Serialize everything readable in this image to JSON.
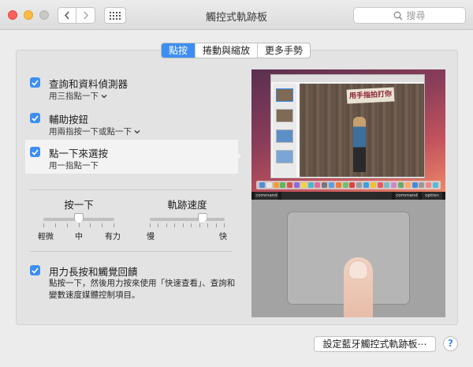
{
  "window": {
    "title": "觸控式軌跡板"
  },
  "search": {
    "placeholder": "搜尋"
  },
  "tabs": [
    {
      "label": "點按",
      "active": true
    },
    {
      "label": "捲動與縮放",
      "active": false
    },
    {
      "label": "更多手勢",
      "active": false
    }
  ],
  "options": [
    {
      "title": "查詢和資料偵測器",
      "subtitle": "用三指點一下",
      "checked": true,
      "has_menu": true
    },
    {
      "title": "輔助按鈕",
      "subtitle": "用兩指按一下或點一下",
      "checked": true,
      "has_menu": true
    },
    {
      "title": "點一下來選按",
      "subtitle": "用一指點一下",
      "checked": true,
      "has_menu": false
    }
  ],
  "sliders": {
    "click": {
      "label": "按一下",
      "ticks": [
        "輕微",
        "中",
        "有力"
      ],
      "value": 0.5
    },
    "tracking": {
      "label": "軌跡速度",
      "ticks": [
        "慢",
        "快"
      ],
      "value": 0.7
    }
  },
  "force_click": {
    "title": "用力長按和觸覺回饋",
    "description": "點按一下，然後用力按來使用「快速查看」、查詢和變數速度媒體控制項目。",
    "checked": true
  },
  "preview": {
    "banner_text": "用手指拍打你",
    "keys": [
      "command",
      "command",
      "option"
    ]
  },
  "bluetooth_button": "設定藍牙觸控式軌跡板⋯",
  "help_label": "?",
  "colors": {
    "accent": "#3d8ef2"
  }
}
